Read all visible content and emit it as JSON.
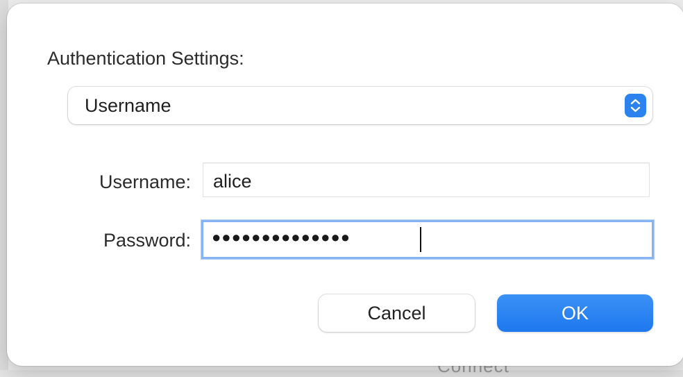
{
  "background": {
    "partial_text": "Connect"
  },
  "dialog": {
    "section_label": "Authentication Settings:",
    "auth_method": {
      "selected": "Username",
      "stepper_icon": "up-down-chevron-icon",
      "accent_color": "#2D83EE"
    },
    "username": {
      "label": "Username:",
      "value": "alice"
    },
    "password": {
      "label": "Password:",
      "masked_value": "●●●●●●●●●●●●●●",
      "focused": true
    },
    "buttons": {
      "cancel_label": "Cancel",
      "ok_label": "OK"
    }
  }
}
